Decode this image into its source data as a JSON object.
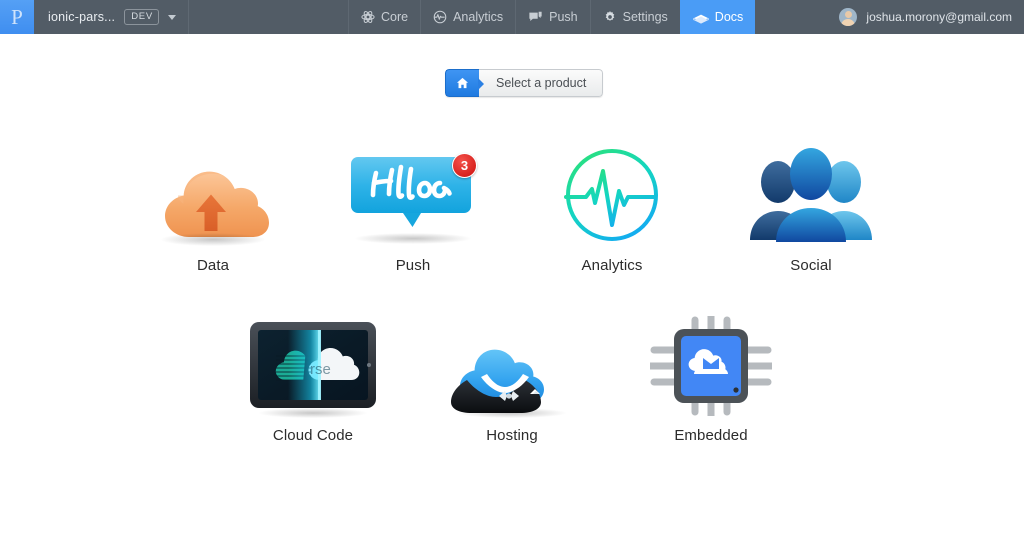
{
  "header": {
    "logo_letter": "P",
    "project_name": "ionic-pars...",
    "env_badge": "DEV",
    "dropdown_icon": "chevron-down-icon",
    "nav": [
      {
        "label": "Core",
        "icon": "atom-icon",
        "active": false
      },
      {
        "label": "Analytics",
        "icon": "pulse-circle-icon",
        "active": false
      },
      {
        "label": "Push",
        "icon": "speech-bubble-icon",
        "active": false
      },
      {
        "label": "Settings",
        "icon": "gear-icon",
        "active": false
      },
      {
        "label": "Docs",
        "icon": "book-icon",
        "active": true
      }
    ],
    "user_email": "joshua.morony@gmail.com",
    "avatar_icon": "user-avatar",
    "bar_color": "#525c66",
    "active_tab_color": "#4a9cf6",
    "logo_color": "#4a9cf6"
  },
  "product_select": {
    "home_icon": "home-icon",
    "label": "Select a product"
  },
  "products": [
    {
      "id": "data",
      "label": "Data",
      "icon": "orange-cloud-upload-icon",
      "color": "#f3a05a",
      "badge": null
    },
    {
      "id": "push",
      "label": "Push",
      "icon": "hello-speech-bubble-icon",
      "color": "#2fb3e8",
      "badge": "3",
      "bubble_text": "Hello"
    },
    {
      "id": "analytics",
      "label": "Analytics",
      "icon": "pulse-circle-icon",
      "color": "#12d0c3",
      "badge": null
    },
    {
      "id": "social",
      "label": "Social",
      "icon": "three-people-icon",
      "color": "#1c5fa8",
      "badge": null
    },
    {
      "id": "cloudcode",
      "label": "Cloud Code",
      "icon": "monitor-cloud-scan-icon",
      "color": "#1f2a33",
      "badge": null
    },
    {
      "id": "hosting",
      "label": "Hosting",
      "icon": "cloud-butler-icon",
      "color": "#3aa4ef",
      "badge": null
    },
    {
      "id": "embedded",
      "label": "Embedded",
      "icon": "microchip-cloud-icon",
      "color": "#4287f5",
      "badge": null
    }
  ],
  "page": {
    "background": "#ffffff",
    "badge_color": "#d6201c"
  }
}
